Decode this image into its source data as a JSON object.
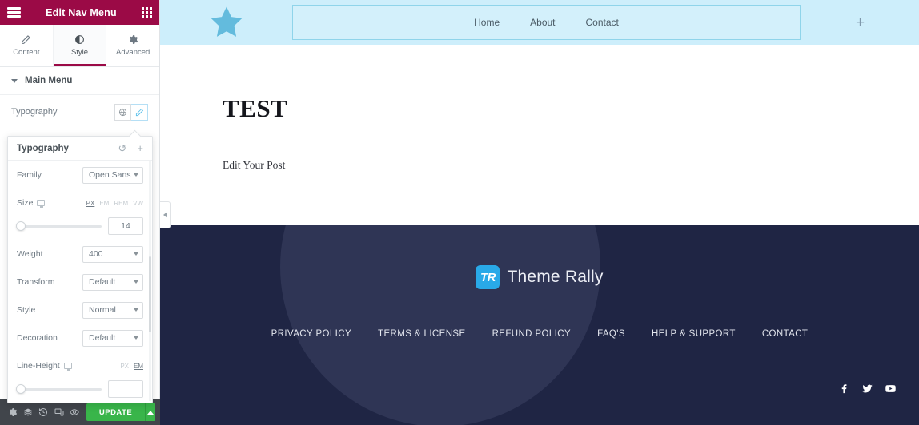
{
  "panel": {
    "header": {
      "title": "Edit Nav Menu",
      "menu_icon": "hamburger-icon",
      "apps_icon": "grid-icon"
    },
    "tabs": [
      {
        "label": "Content",
        "icon": "pencil-icon",
        "active": false
      },
      {
        "label": "Style",
        "icon": "contrast-icon",
        "active": true
      },
      {
        "label": "Advanced",
        "icon": "gear-icon",
        "active": false
      }
    ],
    "section": {
      "label": "Main Menu"
    },
    "typography_row": {
      "label": "Typography",
      "global_icon": "globe-icon",
      "edit_icon": "pencil-edit-icon"
    },
    "popover": {
      "title": "Typography",
      "reset_icon": "reset-icon",
      "add_icon": "plus-icon",
      "controls": {
        "family": {
          "label": "Family",
          "value": "Open Sans"
        },
        "size": {
          "label": "Size",
          "units": [
            "PX",
            "EM",
            "REM",
            "VW"
          ],
          "active_unit": "PX",
          "value": "14",
          "slider_pct": 0
        },
        "weight": {
          "label": "Weight",
          "value": "400"
        },
        "transform": {
          "label": "Transform",
          "value": "Default"
        },
        "style": {
          "label": "Style",
          "value": "Normal"
        },
        "decoration": {
          "label": "Decoration",
          "value": "Default"
        },
        "line_height": {
          "label": "Line-Height",
          "units": [
            "PX",
            "EM"
          ],
          "active_unit": "EM",
          "value": "",
          "slider_pct": 0
        }
      }
    },
    "footer": {
      "icons": [
        "settings-icon",
        "layers-icon",
        "history-icon",
        "responsive-icon",
        "preview-icon"
      ],
      "update_label": "UPDATE",
      "update_caret_icon": "chevron-up-icon"
    },
    "collapse_icon": "chevron-left-icon"
  },
  "preview": {
    "header": {
      "logo_icon": "star-icon",
      "nav_links": [
        "Home",
        "About",
        "Contact"
      ],
      "add_column_icon": "plus-icon"
    },
    "post": {
      "title": "TEST",
      "edit_label": "Edit Your Post"
    },
    "footer": {
      "brand_mark": "TR",
      "brand_name": "Theme Rally",
      "links": [
        "PRIVACY POLICY",
        "TERMS & LICENSE",
        "REFUND POLICY",
        "FAQ'S",
        "HELP & SUPPORT",
        "CONTACT"
      ],
      "social": [
        "facebook-icon",
        "twitter-icon",
        "youtube-icon"
      ]
    }
  },
  "colors": {
    "panel_header": "#9b0a46",
    "update_green": "#39b54a",
    "preview_header": "#cdeefb",
    "footer_navy": "#1f2544",
    "brand_blue": "#29a9e8"
  }
}
